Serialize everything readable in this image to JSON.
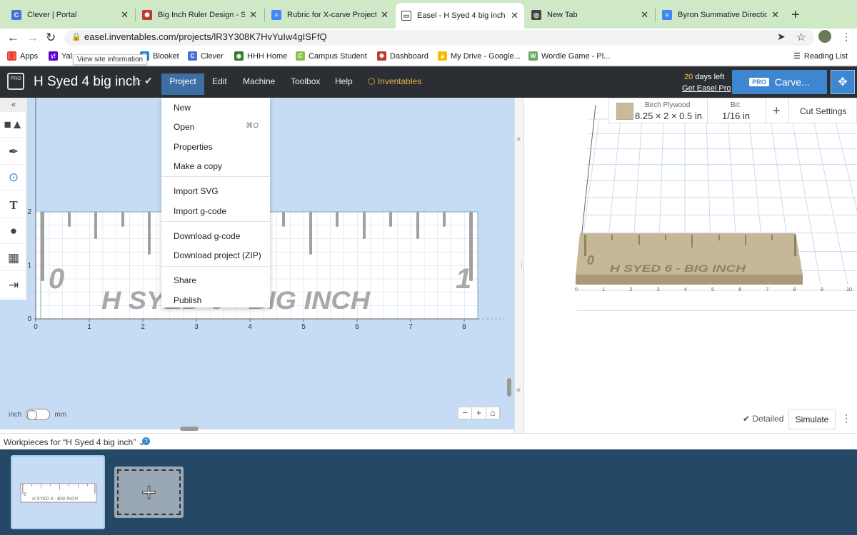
{
  "browser": {
    "tabs": [
      {
        "title": "Clever | Portal",
        "favicon": "C",
        "color": "#4a6fd8"
      },
      {
        "title": "Big Inch Ruler Design - Sub",
        "favicon": "✺",
        "color": "#c0392b"
      },
      {
        "title": "Rubric for X-carve Projects",
        "favicon": "≡",
        "color": "#4285f4"
      },
      {
        "title": "Easel - H Syed 4 big inch",
        "favicon": "▭",
        "color": "#555555",
        "active": true
      },
      {
        "title": "New Tab",
        "favicon": "◎",
        "color": "#444444"
      },
      {
        "title": "Byron Summative Direction",
        "favicon": "≡",
        "color": "#4285f4"
      }
    ],
    "url": "easel.inventables.com/projects/lR3Y308K7HvYuIw4gISFfQ",
    "tooltip": "View site information",
    "bookmarks": [
      {
        "label": "Apps",
        "color": "#ea4335",
        "icon": "⋮⋮"
      },
      {
        "label": "Yal",
        "color": "#6001d2",
        "icon": "y!"
      },
      {
        "label": "Blooket",
        "color": "#1e88e5",
        "icon": "B"
      },
      {
        "label": "Clever",
        "color": "#4a6fd8",
        "icon": "C"
      },
      {
        "label": "HHH Home",
        "color": "#2e7d32",
        "icon": "◉"
      },
      {
        "label": "Campus Student",
        "color": "#8bc34a",
        "icon": "C"
      },
      {
        "label": "Dashboard",
        "color": "#c0392b",
        "icon": "✺"
      },
      {
        "label": "My Drive - Google...",
        "color": "#fbbc05",
        "icon": "▲"
      },
      {
        "label": "Wordle Game - Pl...",
        "color": "#6aaa64",
        "icon": "W"
      }
    ],
    "reading_list": "Reading List"
  },
  "header": {
    "logo": "PRO",
    "title": "H Syed 4 big inch",
    "menus": [
      "Project",
      "Edit",
      "Machine",
      "Toolbox",
      "Help"
    ],
    "inventables": "Inventables",
    "days_left_num": "20",
    "days_left_text": "days left",
    "get_pro": "Get Easel Pro",
    "carve_badge": "PRO",
    "carve_label": "Carve..."
  },
  "dropdown": {
    "items": [
      "New",
      "Open",
      "Properties",
      "Make a copy",
      "Import SVG",
      "Import g-code",
      "Download g-code",
      "Download project (ZIP)",
      "Share",
      "Publish"
    ],
    "open_shortcut": "⌘O"
  },
  "canvas": {
    "x_ticks": [
      "0",
      "1",
      "2",
      "3",
      "4",
      "5",
      "6",
      "7",
      "8"
    ],
    "y_ticks": [
      "0",
      "1",
      "2"
    ],
    "ruler_start": "0",
    "ruler_end": "1",
    "engraved_text": "H SYED 6 - BIG INCH",
    "unit_inch": "inch",
    "unit_mm": "mm",
    "zoom_minus": "−",
    "zoom_plus": "+",
    "home": "⌂"
  },
  "preview": {
    "material_name": "Birch Plywood",
    "material_dims": "8.25 × 2 × 0.5 in",
    "bit_label": "Bit:",
    "bit_value": "1/16 in",
    "add": "+",
    "cut_settings": "Cut Settings",
    "detailed": "✔ Detailed",
    "simulate": "Simulate",
    "x_ticks": [
      "0",
      "1",
      "2",
      "3",
      "4",
      "5",
      "6",
      "7",
      "8",
      "9",
      "10"
    ],
    "engraved_text": "H SYED 6 - BIG INCH"
  },
  "workpieces": {
    "label": "Workpieces for “H Syed 4 big inch” ⌄",
    "help": "?"
  }
}
